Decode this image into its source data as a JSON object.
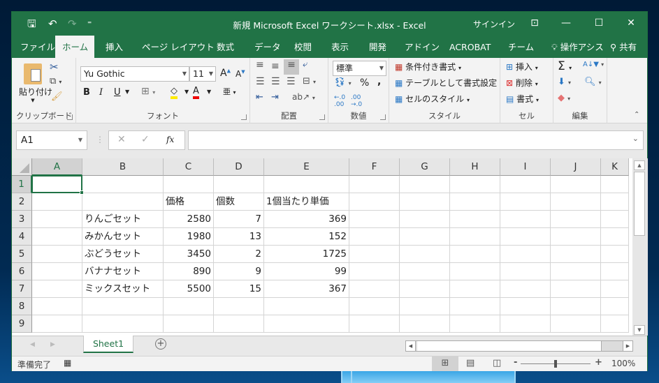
{
  "window": {
    "title": "新規 Microsoft Excel ワークシート.xlsx  -  Excel",
    "signin": "サインイン",
    "controls": {
      "ribbon_display": "⊡",
      "minimize": "—",
      "maximize": "☐",
      "close": "✕"
    }
  },
  "quick_access": {
    "save": "🖫",
    "undo": "↶",
    "redo": "↷",
    "customize": "⁼"
  },
  "tabs": [
    {
      "label": "ファイル"
    },
    {
      "label": "ホーム",
      "active": true
    },
    {
      "label": "挿入"
    },
    {
      "label": "ページ レイアウト"
    },
    {
      "label": "数式"
    },
    {
      "label": "データ"
    },
    {
      "label": "校閲"
    },
    {
      "label": "表示"
    },
    {
      "label": "開発"
    },
    {
      "label": "アドイン"
    },
    {
      "label": "ACROBAT"
    },
    {
      "label": "チーム"
    },
    {
      "label": "操作アシス"
    },
    {
      "label": "共有"
    }
  ],
  "ribbon": {
    "clipboard": {
      "label": "クリップボード",
      "paste": "貼り付け"
    },
    "font": {
      "label": "フォント",
      "font_name": "Yu Gothic",
      "font_size": "11",
      "bold": "B",
      "italic": "I",
      "underline": "U"
    },
    "alignment": {
      "label": "配置"
    },
    "number": {
      "label": "数値",
      "format": "標準",
      "percent": "%",
      "comma": ","
    },
    "styles": {
      "label": "スタイル",
      "conditional": "条件付き書式",
      "table": "テーブルとして書式設定",
      "cell_styles": "セルのスタイル"
    },
    "cells": {
      "label": "セル",
      "insert": "挿入",
      "delete": "削除",
      "format": "書式"
    },
    "editing": {
      "label": "編集"
    }
  },
  "formula_bar": {
    "name_box": "A1",
    "fx": "fx",
    "cancel": "✕",
    "enter": "✓",
    "formula": ""
  },
  "sheet": {
    "columns": [
      "A",
      "B",
      "C",
      "D",
      "E",
      "F",
      "G",
      "H",
      "I",
      "J",
      "K"
    ],
    "rows": [
      "1",
      "2",
      "3",
      "4",
      "5",
      "6",
      "7",
      "8",
      "9"
    ],
    "selected_cell": "A1",
    "cells": [
      {
        "ref": "C2",
        "value": "価格"
      },
      {
        "ref": "D2",
        "value": "個数"
      },
      {
        "ref": "E2",
        "value": "1個当たり単価"
      },
      {
        "ref": "B3",
        "value": "りんごセット"
      },
      {
        "ref": "C3",
        "value": "2580",
        "num": true
      },
      {
        "ref": "D3",
        "value": "7",
        "num": true
      },
      {
        "ref": "E3",
        "value": "369",
        "num": true
      },
      {
        "ref": "B4",
        "value": "みかんセット"
      },
      {
        "ref": "C4",
        "value": "1980",
        "num": true
      },
      {
        "ref": "D4",
        "value": "13",
        "num": true
      },
      {
        "ref": "E4",
        "value": "152",
        "num": true
      },
      {
        "ref": "B5",
        "value": "ぶどうセット"
      },
      {
        "ref": "C5",
        "value": "3450",
        "num": true
      },
      {
        "ref": "D5",
        "value": "2",
        "num": true
      },
      {
        "ref": "E5",
        "value": "1725",
        "num": true
      },
      {
        "ref": "B6",
        "value": "バナナセット"
      },
      {
        "ref": "C6",
        "value": "890",
        "num": true
      },
      {
        "ref": "D6",
        "value": "9",
        "num": true
      },
      {
        "ref": "E6",
        "value": "99",
        "num": true
      },
      {
        "ref": "B7",
        "value": "ミックスセット"
      },
      {
        "ref": "C7",
        "value": "5500",
        "num": true
      },
      {
        "ref": "D7",
        "value": "15",
        "num": true
      },
      {
        "ref": "E7",
        "value": "367",
        "num": true
      }
    ]
  },
  "sheet_tabs": [
    {
      "label": "Sheet1",
      "active": true
    }
  ],
  "status": {
    "text": "準備完了",
    "zoom": "100%",
    "zoom_percent": 100
  },
  "colors": {
    "brand": "#217346"
  }
}
